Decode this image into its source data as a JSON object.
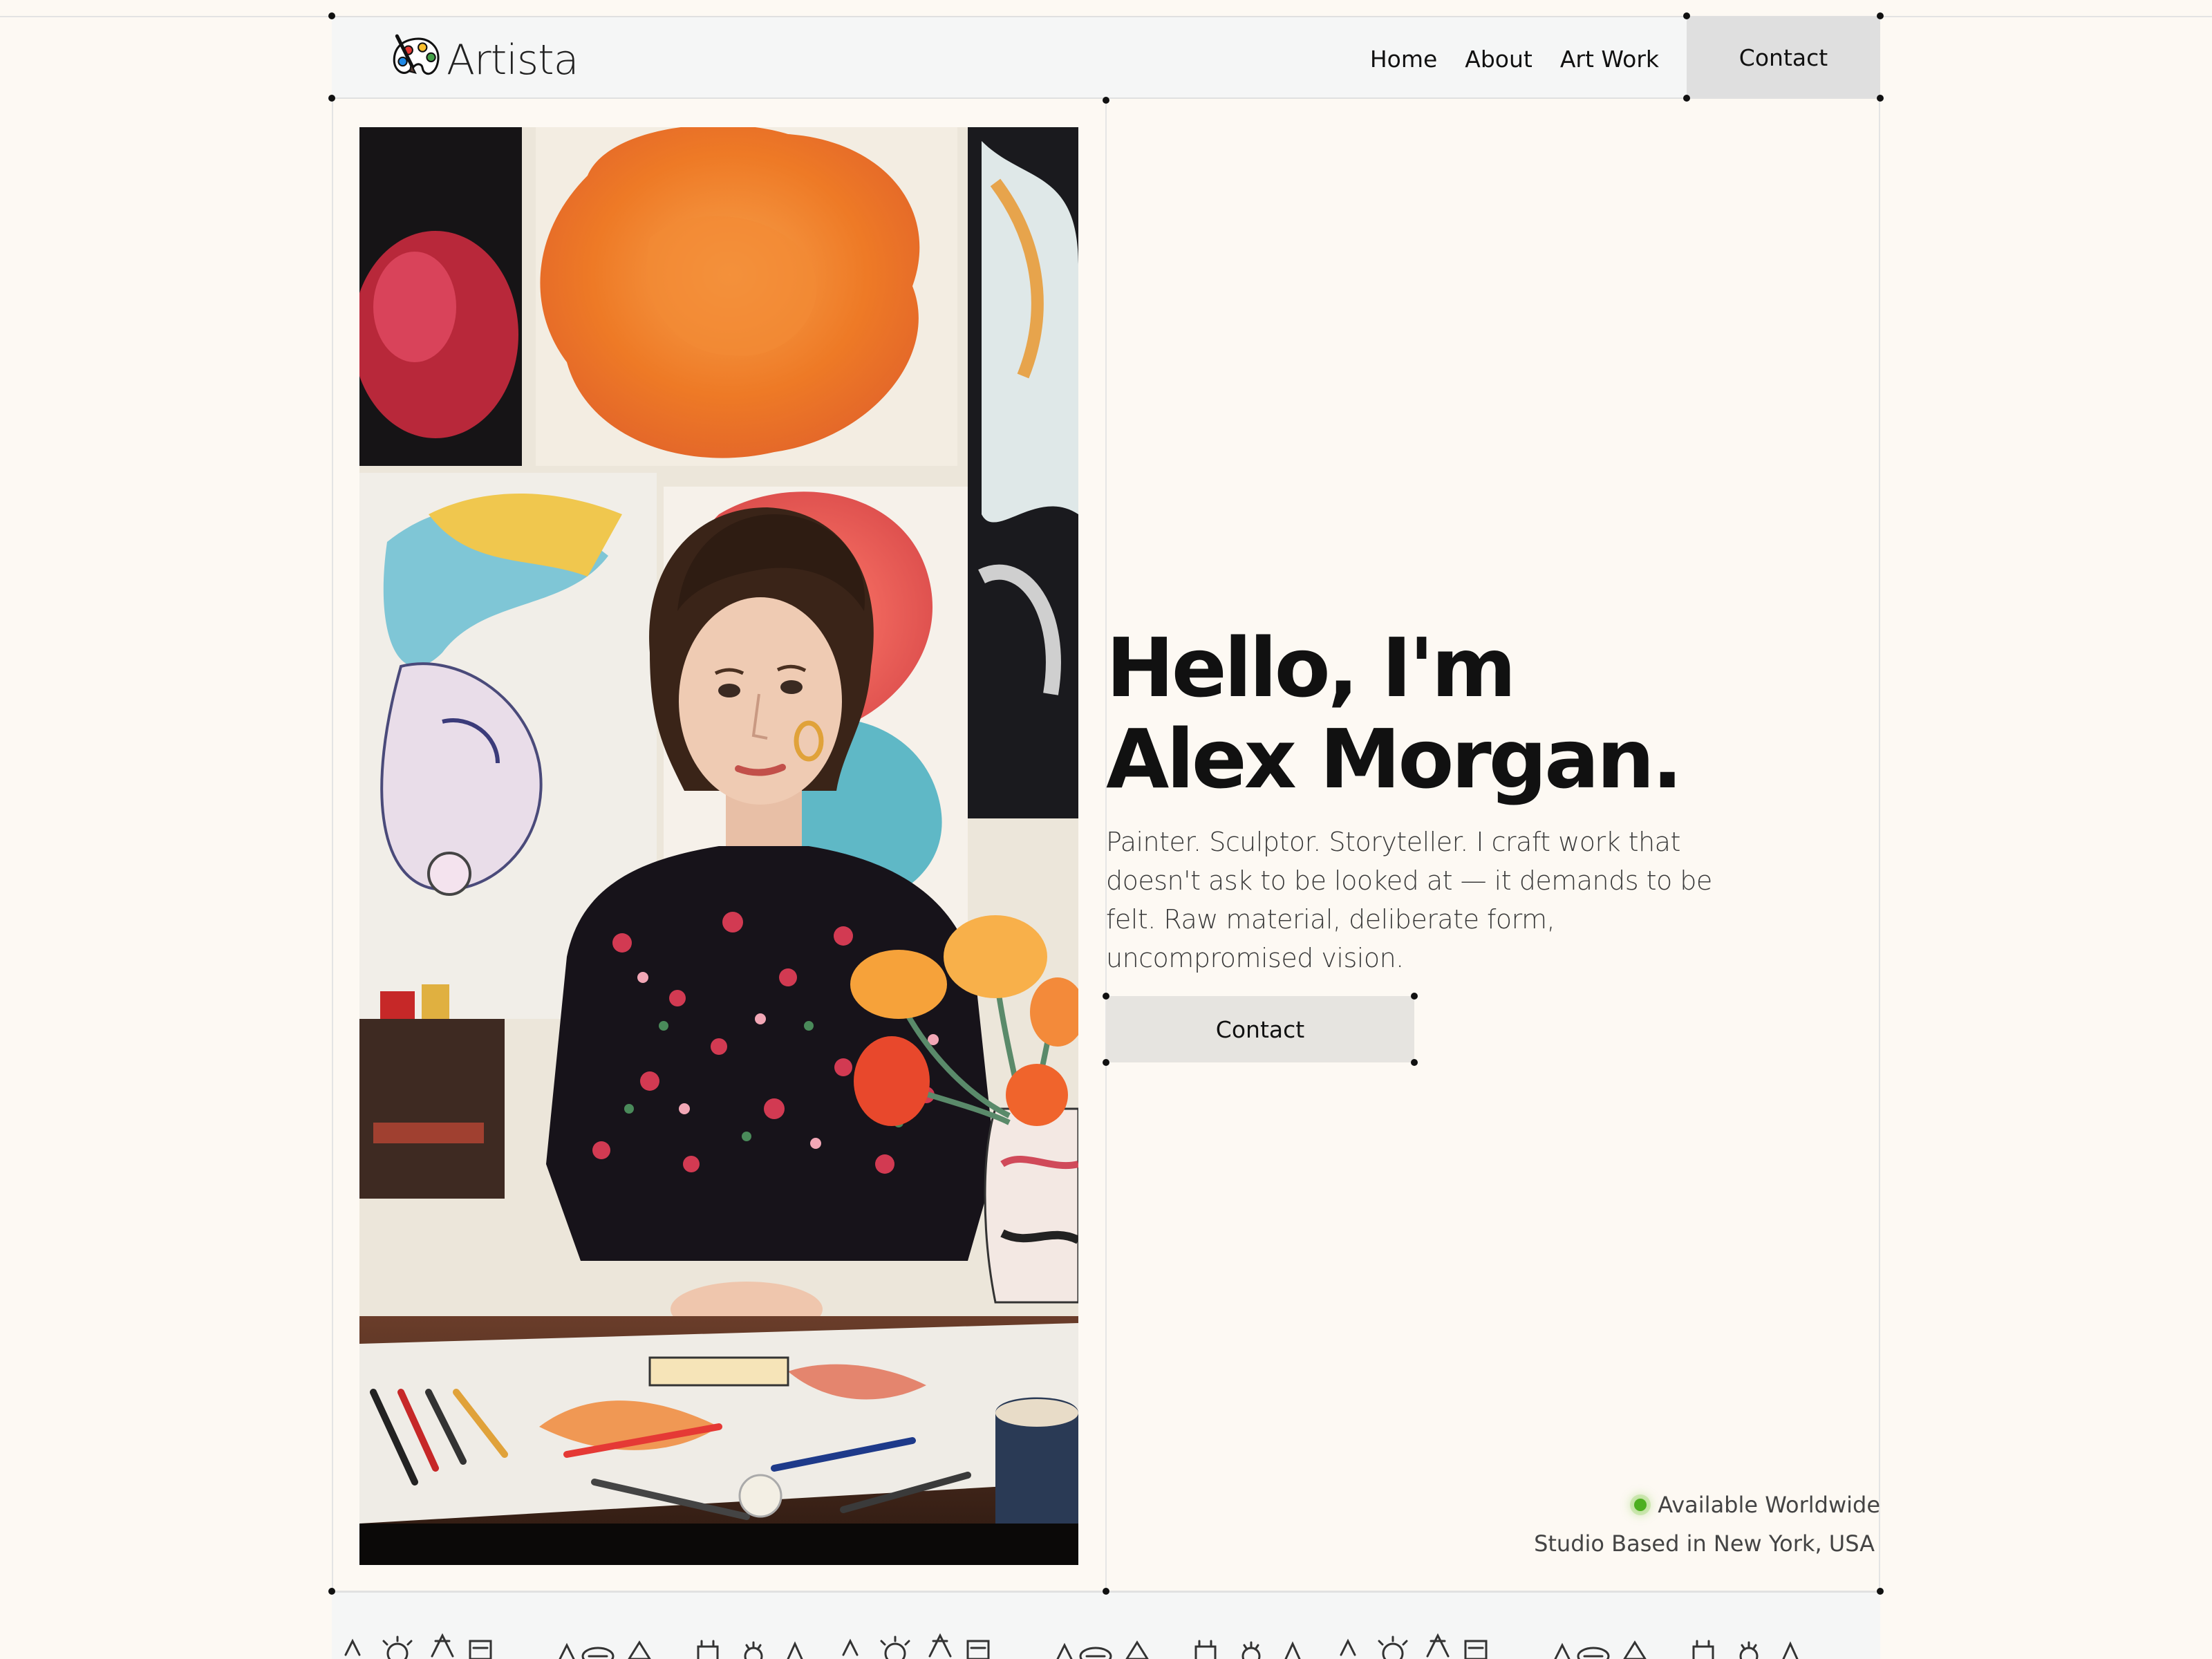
{
  "brand": {
    "name": "Artista",
    "logo_icon": "palette-brush-icon"
  },
  "nav": {
    "links": [
      {
        "label": "Home"
      },
      {
        "label": "About"
      },
      {
        "label": "Art Work"
      }
    ],
    "contact_label": "Contact"
  },
  "hero": {
    "title_line1": "Hello, I'm",
    "title_line2": "Alex Morgan.",
    "description": "Painter. Sculptor. Storyteller. I craft work that doesn't ask to be looked at — it demands to be felt. Raw material, deliberate form, uncompromised vision.",
    "contact_label": "Contact"
  },
  "status": {
    "availability": "Available Worldwide",
    "studio": "Studio Based in New York, USA",
    "indicator_color": "#4caf1f"
  },
  "colors": {
    "page_bg": "#fdf9f3",
    "nav_bg": "#f5f6f6",
    "button_bg": "#dfdfdf"
  }
}
